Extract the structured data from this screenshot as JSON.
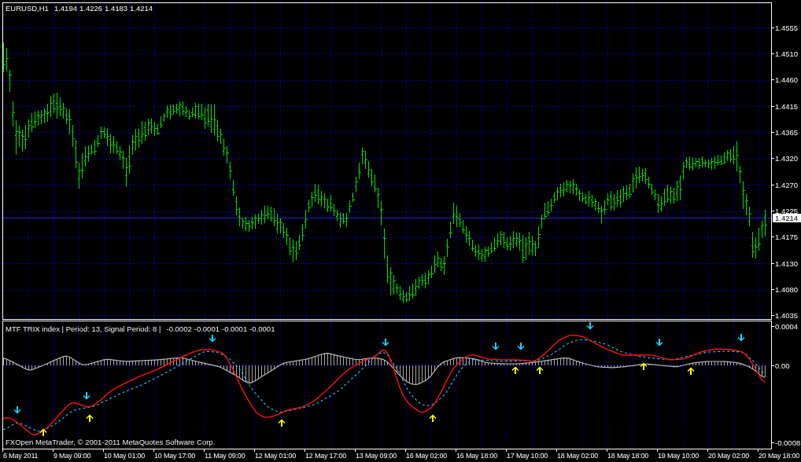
{
  "chart": {
    "symbol": "EURUSD,H1",
    "ohlc": [
      "1.4194",
      "1.4226",
      "1.4183",
      "1.4214"
    ],
    "price_axis": [
      "1.4555",
      "1.4510",
      "1.4460",
      "1.4415",
      "1.4365",
      "1.4320",
      "1.4270",
      "1.4225",
      "1.4175",
      "1.4130",
      "1.4080",
      "1.4035"
    ],
    "bid_marker": "1.4214"
  },
  "indicator": {
    "title": "MTF TRIX index | Period: 13, Signal Period: 8 |",
    "values": [
      "-0.0002",
      "-0.0001",
      "-0.0001",
      "-0.0001"
    ],
    "axis": [
      "0.0004",
      "0.00",
      "-0.0008"
    ]
  },
  "copyright": "FXOpen MetaTrader, © 2001-2011 MetaQuotes Software Corp.",
  "time_axis": [
    "6 May 2011",
    "9 May 09:00",
    "10 May 01:00",
    "10 May 17:00",
    "11 May 09:00",
    "12 May 01:00",
    "12 May 17:00",
    "13 May 09:00",
    "16 May 02:00",
    "16 May 18:00",
    "17 May 10:00",
    "18 May 02:00",
    "18 May 18:00",
    "19 May 10:00",
    "20 May 02:00",
    "20 May 18:00"
  ]
}
